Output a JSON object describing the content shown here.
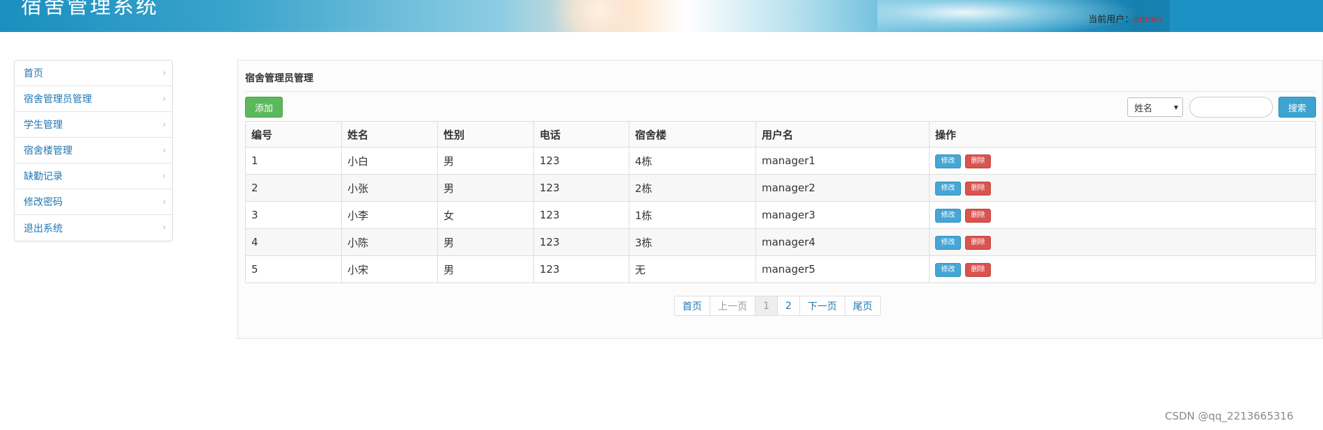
{
  "header": {
    "title": "宿舍管理系统",
    "user_label": "当前用户：",
    "user_name": "admin"
  },
  "sidebar": {
    "items": [
      {
        "label": "首页"
      },
      {
        "label": "宿舍管理员管理"
      },
      {
        "label": "学生管理"
      },
      {
        "label": "宿舍楼管理"
      },
      {
        "label": "缺勤记录"
      },
      {
        "label": "修改密码"
      },
      {
        "label": "退出系统"
      }
    ],
    "chevron": "›"
  },
  "main": {
    "title": "宿舍管理员管理",
    "add_label": "添加",
    "search": {
      "select_value": "姓名",
      "input_value": "",
      "button_label": "搜索"
    },
    "table": {
      "headers": [
        "编号",
        "姓名",
        "性别",
        "电话",
        "宿舍楼",
        "用户名",
        "操作"
      ],
      "rows": [
        [
          "1",
          "小白",
          "男",
          "123",
          "4栋",
          "manager1"
        ],
        [
          "2",
          "小张",
          "男",
          "123",
          "2栋",
          "manager2"
        ],
        [
          "3",
          "小李",
          "女",
          "123",
          "1栋",
          "manager3"
        ],
        [
          "4",
          "小陈",
          "男",
          "123",
          "3栋",
          "manager4"
        ],
        [
          "5",
          "小宋",
          "男",
          "123",
          "无",
          "manager5"
        ]
      ],
      "edit_label": "修改",
      "delete_label": "删除"
    },
    "pagination": {
      "first": "首页",
      "prev": "上一页",
      "pages": [
        "1",
        "2"
      ],
      "current": "1",
      "next": "下一页",
      "last": "尾页"
    }
  },
  "watermark": "CSDN @qq_2213665316",
  "colors": {
    "accent": "#1f77b4",
    "add_button": "#5cb85c",
    "search_button": "#3ea3cf",
    "edit_button": "#46a6d6",
    "delete_button": "#d9534f",
    "user_name": "#e02020"
  }
}
